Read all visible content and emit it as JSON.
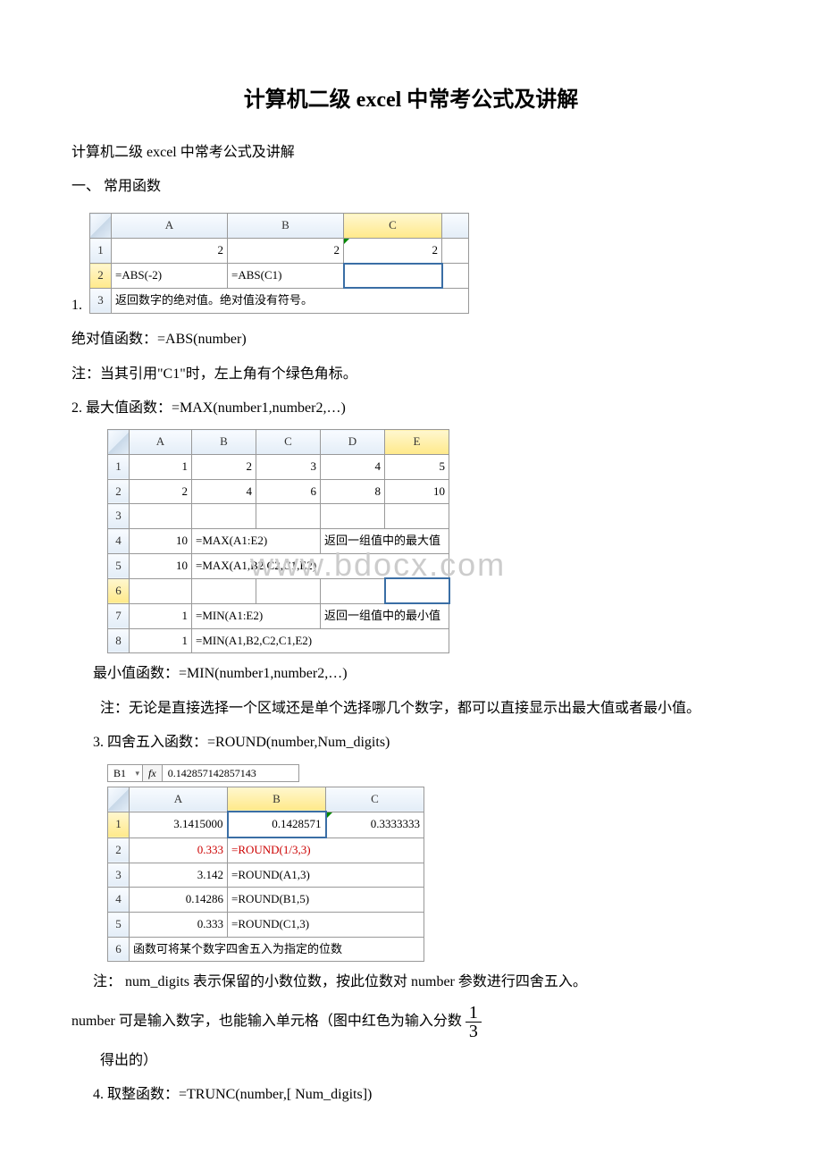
{
  "title": "计算机二级 excel 中常考公式及讲解",
  "subtitle": "计算机二级 excel 中常考公式及讲解",
  "section1": "一、 常用函数",
  "table1": {
    "cols": [
      "A",
      "B",
      "C"
    ],
    "rows": [
      {
        "r": "1",
        "a": "2",
        "b": "2",
        "c": "2"
      },
      {
        "r": "2",
        "a": "=ABS(-2)",
        "b": "=ABS(C1)",
        "c": ""
      },
      {
        "r": "3",
        "merged": "返回数字的绝对值。绝对值没有符号。"
      }
    ],
    "prefix": "1."
  },
  "p1": "绝对值函数：=ABS(number)",
  "p2": "注：当其引用\"C1\"时，左上角有个绿色角标。",
  "p3": "2. 最大值函数：=MAX(number1,number2,…)",
  "table2": {
    "cols": [
      "A",
      "B",
      "C",
      "D",
      "E"
    ],
    "rows": [
      {
        "r": "1",
        "v": [
          "1",
          "2",
          "3",
          "4",
          "5"
        ]
      },
      {
        "r": "2",
        "v": [
          "2",
          "4",
          "6",
          "8",
          "10"
        ]
      },
      {
        "r": "3",
        "v": [
          "",
          "",
          "",
          "",
          ""
        ]
      },
      {
        "r": "4",
        "a": "10",
        "formula": "=MAX(A1:E2)",
        "note": "返回一组值中的最大值"
      },
      {
        "r": "5",
        "a": "10",
        "formula": "=MAX(A1,B2,C2,C1,E2)"
      },
      {
        "r": "6",
        "v": [
          "",
          "",
          "",
          "",
          ""
        ]
      },
      {
        "r": "7",
        "a": "1",
        "formula": "=MIN(A1:E2)",
        "note": "返回一组值中的最小值"
      },
      {
        "r": "8",
        "a": "1",
        "formula": "=MIN(A1,B2,C2,C1,E2)"
      }
    ]
  },
  "watermark": "www.bdocx.com",
  "p4": "最小值函数：=MIN(number1,number2,…)",
  "p5": "注：无论是直接选择一个区域还是单个选择哪几个数字，都可以直接显示出最大值或者最小值。",
  "p6": "3. 四舍五入函数：=ROUND(number,Num_digits)",
  "formulabar": {
    "name": "B1",
    "fx": "fx",
    "value": "0.142857142857143"
  },
  "table3": {
    "cols": [
      "A",
      "B",
      "C"
    ],
    "rows": [
      {
        "r": "1",
        "a": "3.1415000",
        "b": "0.1428571",
        "c": "0.3333333"
      },
      {
        "r": "2",
        "a": "0.333",
        "formula": "=ROUND(1/3,3)",
        "red": true
      },
      {
        "r": "3",
        "a": "3.142",
        "formula": "=ROUND(A1,3)"
      },
      {
        "r": "4",
        "a": "0.14286",
        "formula": "=ROUND(B1,5)"
      },
      {
        "r": "5",
        "a": "0.333",
        "formula": "=ROUND(C1,3)"
      },
      {
        "r": "6",
        "merged": "函数可将某个数字四舍五入为指定的位数"
      }
    ]
  },
  "p7a": "注： num_digits 表示保留的小数位数，按此位数对 number 参数进行四舍五入。",
  "p7b_prefix": "number 可是输入数字，也能输入单元格（图中红色为输入分数",
  "frac": {
    "n": "1",
    "d": "3"
  },
  "p8": "得出的）",
  "p9": "4. 取整函数：=TRUNC(number,[ Num_digits])"
}
